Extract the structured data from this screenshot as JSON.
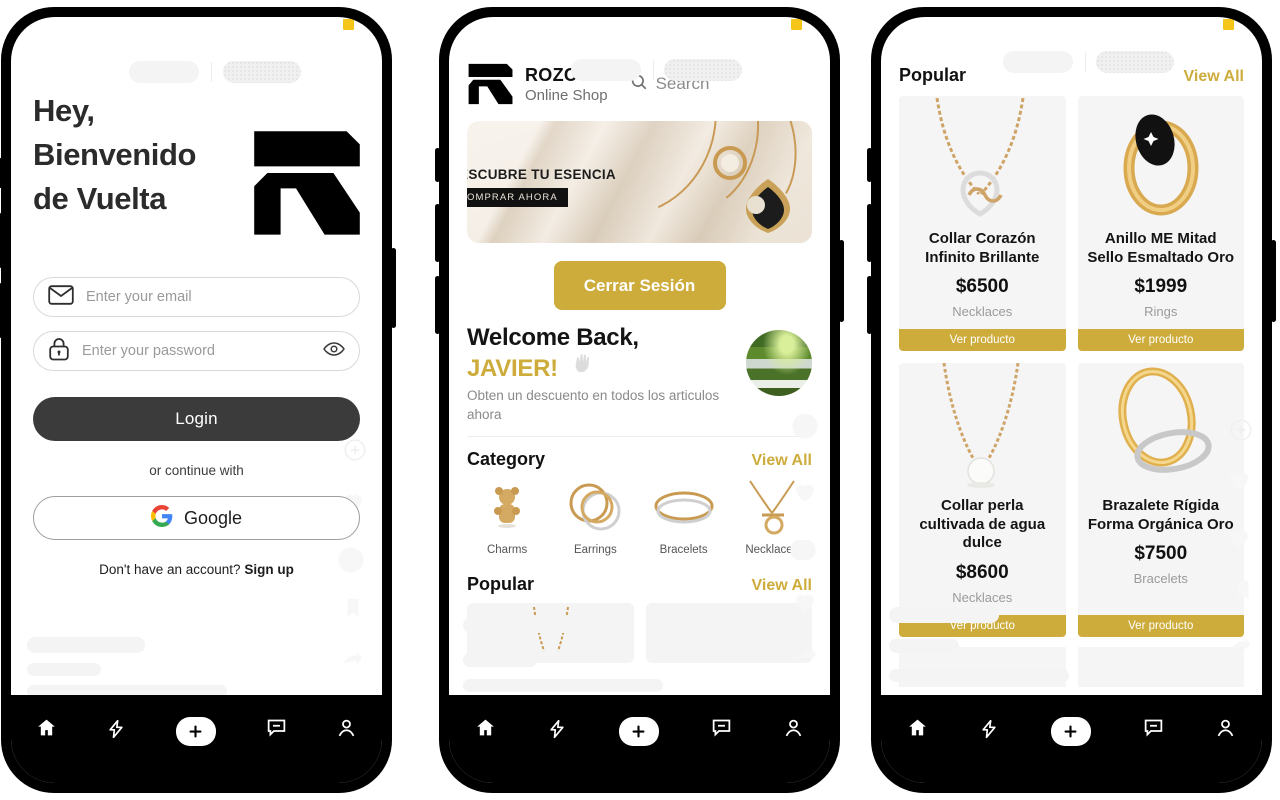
{
  "accent_gold": "#cdac3b",
  "dark_button": "#3b3b3b",
  "phone1": {
    "name": "login-screen",
    "headline": "Hey,\nBienvenido\nde Vuelta",
    "logo_alt": "rozco-logo",
    "email": {
      "placeholder": "Enter your email",
      "value": "",
      "icon": "envelope-icon"
    },
    "password": {
      "placeholder": "Enter your password",
      "value": "",
      "icon": "lock-icon",
      "toggle_icon": "eye-icon"
    },
    "login_label": "Login",
    "divider_label": "or continue with",
    "google_label": "Google",
    "signup_prompt": "Don't have an account?",
    "signup_link": "Sign up"
  },
  "phone2": {
    "name": "home-screen",
    "brand": {
      "title": "ROZCO",
      "subtitle": "Online Shop"
    },
    "search": {
      "placeholder": "Search",
      "icon": "search-icon"
    },
    "hero": {
      "title": "DESCUBRE TU ESENCIA",
      "cta": "COMPRAR AHORA"
    },
    "logout_label": "Cerrar Sesión",
    "welcome": {
      "line1": "Welcome Back,",
      "user": "JAVIER!",
      "wave_icon": "waving-hand-icon",
      "subtitle": "Obten un descuento en todos los articulos ahora"
    },
    "category_section": {
      "title": "Category",
      "view_all": "View All"
    },
    "categories": [
      {
        "label": "Charms",
        "icon": "charm-bear-icon"
      },
      {
        "label": "Earrings",
        "icon": "earrings-icon"
      },
      {
        "label": "Bracelets",
        "icon": "bracelet-icon"
      },
      {
        "label": "Necklaces",
        "icon": "necklace-icon"
      }
    ],
    "popular_section": {
      "title": "Popular",
      "view_all": "View All"
    }
  },
  "phone3": {
    "name": "popular-products-screen",
    "section": {
      "title": "Popular",
      "view_all": "View All"
    },
    "products": [
      {
        "name": "Collar Corazón Infinito Brillante",
        "price": "$6500",
        "category": "Necklaces",
        "cta": "Ver producto",
        "image": "heart-infinity-necklace"
      },
      {
        "name": "Anillo ME Mitad Sello Esmaltado Oro",
        "price": "$1999",
        "category": "Rings",
        "cta": "Ver producto",
        "image": "enamel-signet-ring"
      },
      {
        "name": "Collar perla cultivada de agua dulce",
        "price": "$8600",
        "category": "Necklaces",
        "cta": "Ver producto",
        "image": "pearl-necklace"
      },
      {
        "name": "Brazalete Rígida Forma Orgánica Oro",
        "price": "$7500",
        "category": "Bracelets",
        "cta": "Ver producto",
        "image": "organic-bangle"
      }
    ]
  },
  "bottom_nav": [
    {
      "icon": "home-icon",
      "label": "Home"
    },
    {
      "icon": "lightning-icon",
      "label": "Flash"
    },
    {
      "icon": "plus-icon",
      "label": "Create"
    },
    {
      "icon": "chat-icon",
      "label": "Messages"
    },
    {
      "icon": "person-icon",
      "label": "Profile"
    }
  ]
}
